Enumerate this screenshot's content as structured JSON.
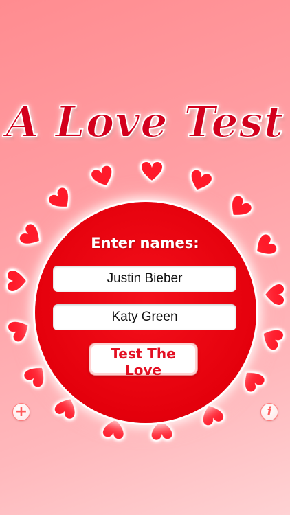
{
  "app": {
    "title": "A Love Test",
    "prompt": "Enter names:",
    "name_one": "Justin Bieber",
    "name_two": "Katy Green",
    "test_button": "Test The Love",
    "add_glyph": "+",
    "info_glyph": "i"
  },
  "icons": {
    "decor": "heart-icon",
    "add": "plus-icon",
    "info": "info-icon"
  },
  "colors": {
    "background_top": "#ff8c90",
    "background_bottom": "#ffd2d4",
    "circle": "#e4000c",
    "heart": "#ff1a2a",
    "title": "#d3001d",
    "button_text": "#e30f22"
  }
}
